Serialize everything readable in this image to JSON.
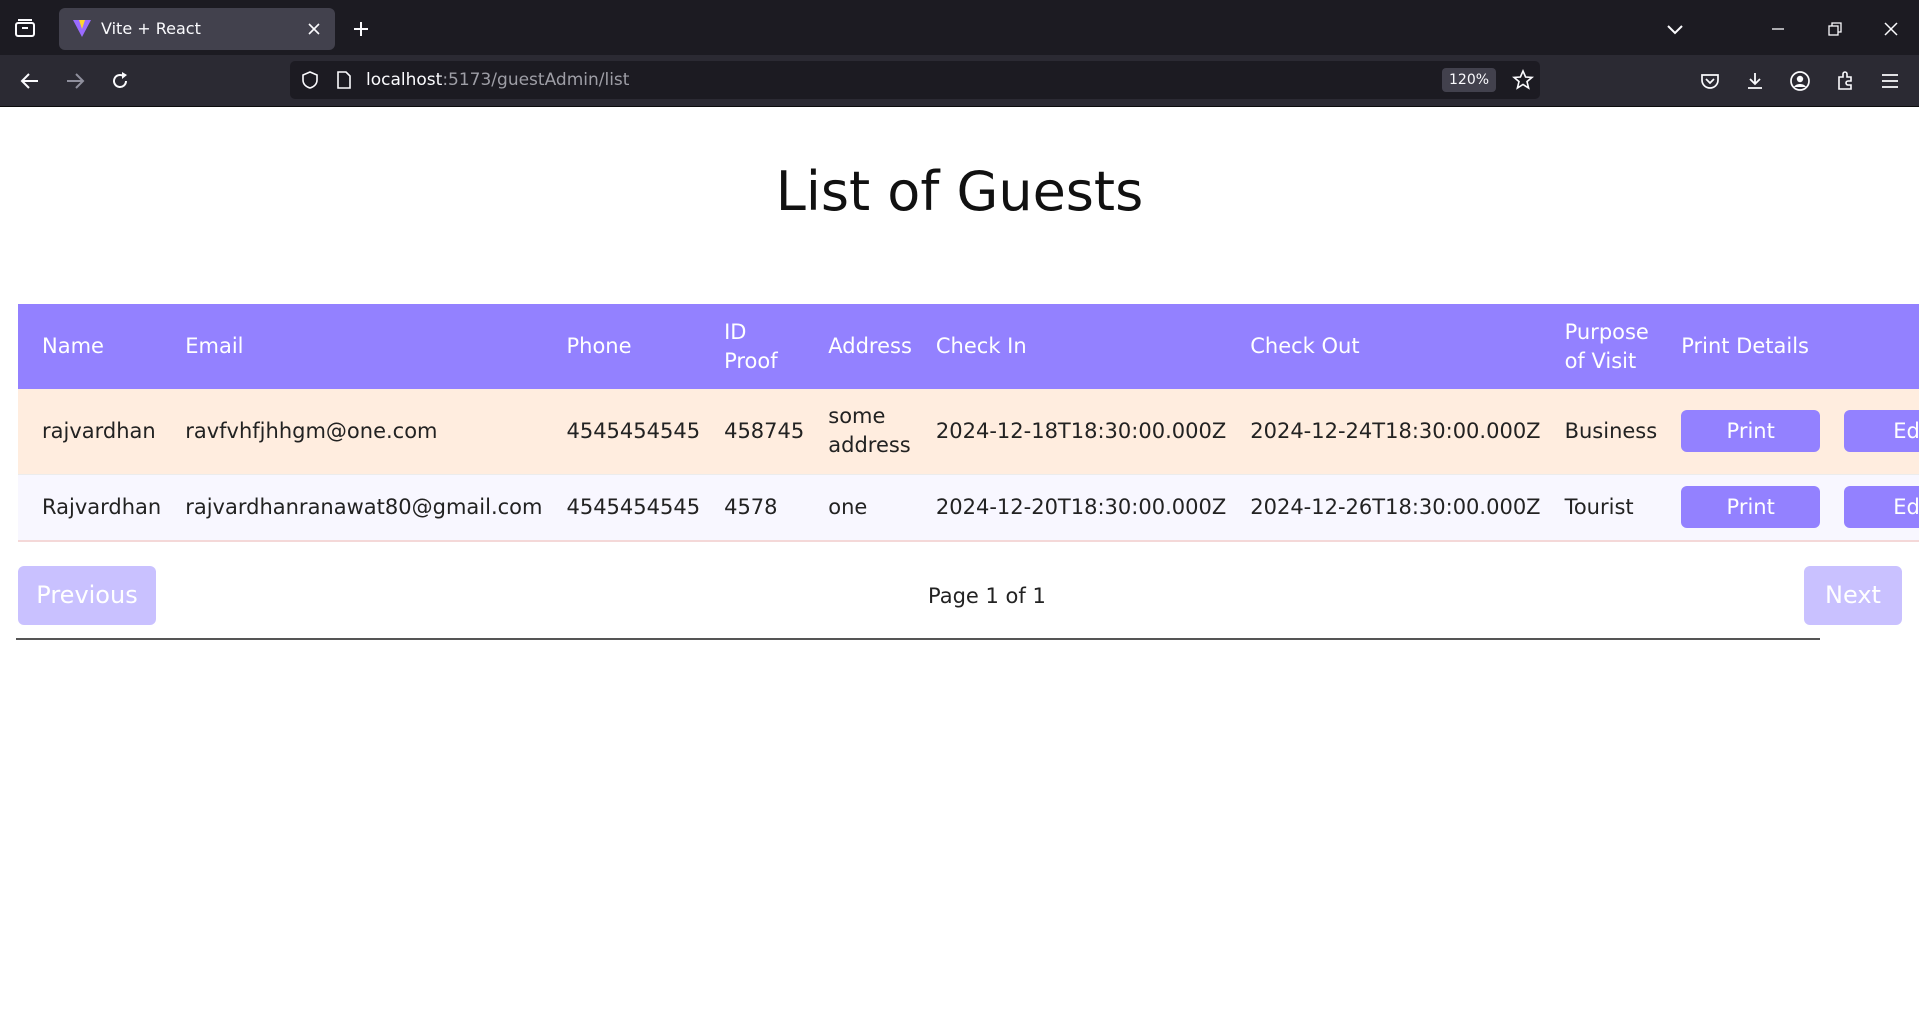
{
  "browser": {
    "tab_title": "Vite + React",
    "url_host": "localhost",
    "url_path": ":5173/guestAdmin/list",
    "zoom": "120%"
  },
  "page": {
    "title": "List of Guests"
  },
  "table": {
    "headers": {
      "name": "Name",
      "email": "Email",
      "phone": "Phone",
      "id_proof_1": "ID",
      "id_proof_2": "Proof",
      "address": "Address",
      "check_in": "Check In",
      "check_out": "Check Out",
      "purpose_1": "Purpose",
      "purpose_2": "of Visit",
      "print_details": "Print Details"
    },
    "rows": [
      {
        "name": "rajvardhan",
        "email": "ravfvhfjhhgm@one.com",
        "phone": "4545454545",
        "id_proof": "458745",
        "address_1": "some",
        "address_2": "address",
        "check_in": "2024-12-18T18:30:00.000Z",
        "check_out": "2024-12-24T18:30:00.000Z",
        "purpose": "Business",
        "print_label": "Print",
        "edit_label": "Edit"
      },
      {
        "name": "Rajvardhan",
        "email": "rajvardhanranawat80@gmail.com",
        "phone": "4545454545",
        "id_proof": "4578",
        "address_1": "one",
        "address_2": "",
        "check_in": "2024-12-20T18:30:00.000Z",
        "check_out": "2024-12-26T18:30:00.000Z",
        "purpose": "Tourist",
        "print_label": "Print",
        "edit_label": "Edit"
      }
    ]
  },
  "pagination": {
    "previous_label": "Previous",
    "page_info": "Page 1 of 1",
    "next_label": "Next"
  }
}
